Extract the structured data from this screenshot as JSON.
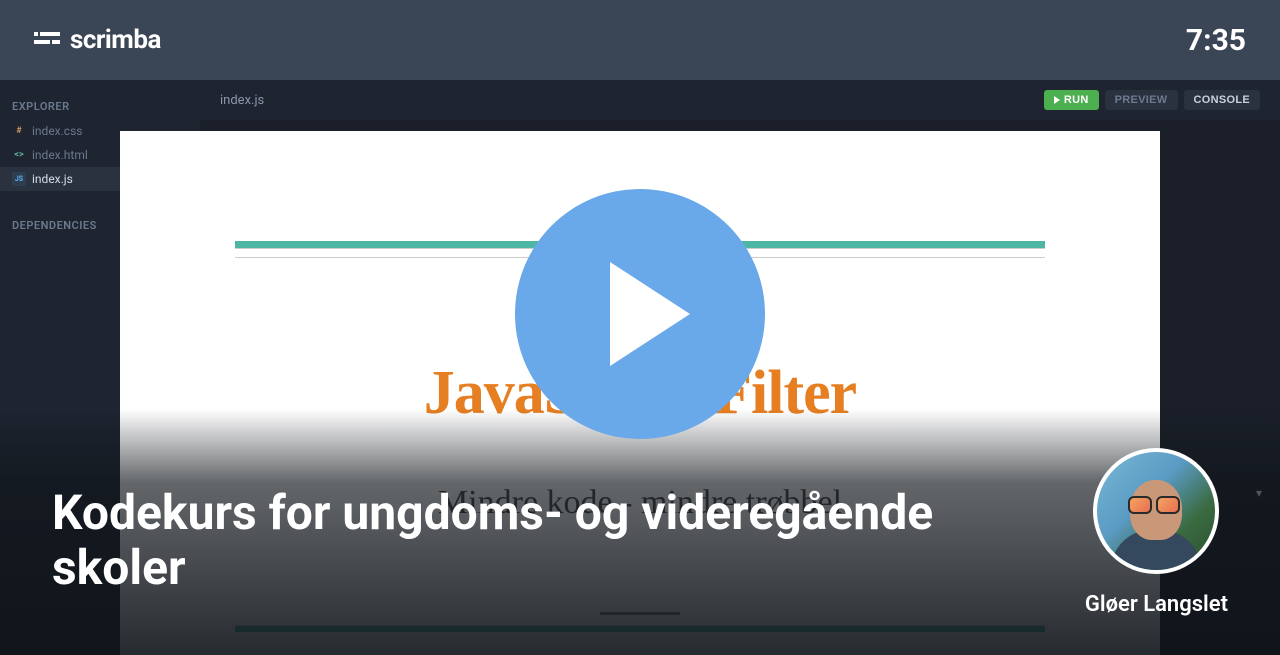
{
  "header": {
    "brand": "scrimba",
    "timer": "7:35"
  },
  "sidebar": {
    "explorer_label": "EXPLORER",
    "dependencies_label": "DEPENDENCIES",
    "files": [
      {
        "name": "index.css",
        "icon": "#",
        "active": false
      },
      {
        "name": "index.html",
        "icon": "<>",
        "active": false
      },
      {
        "name": "index.js",
        "icon": "JS",
        "active": true
      }
    ]
  },
  "tabs": {
    "active_file": "index.js"
  },
  "toolbar": {
    "run_label": "RUN",
    "preview_label": "PREVIEW",
    "console_label": "CONSOLE"
  },
  "preview": {
    "title": "JavaScript Filter",
    "subtitle": "Mindre kode - mindre trøbbel"
  },
  "video": {
    "title": "Kodekurs for ungdoms- og videregående skoler",
    "author": "Gløer Langslet"
  }
}
